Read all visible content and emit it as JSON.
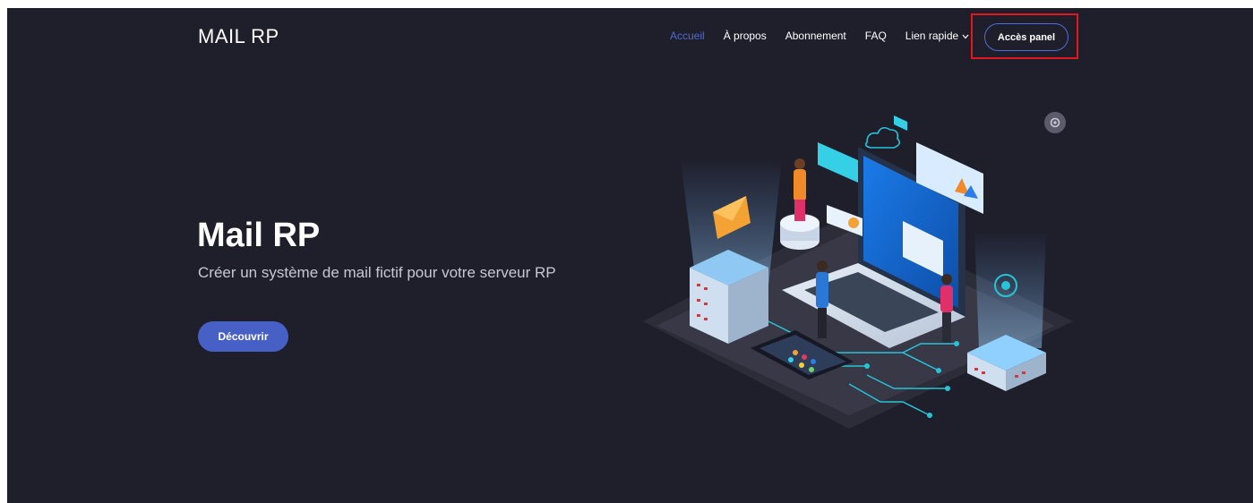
{
  "header": {
    "logo": "MAIL RP",
    "nav": [
      {
        "label": "Accueil",
        "active": true
      },
      {
        "label": "À propos",
        "active": false
      },
      {
        "label": "Abonnement",
        "active": false
      },
      {
        "label": "FAQ",
        "active": false
      },
      {
        "label": "Lien rapide",
        "active": false,
        "has_dropdown": true
      }
    ],
    "cta_label": "Accès panel"
  },
  "hero": {
    "title": "Mail RP",
    "subtitle": "Créer un système de mail fictif pour votre serveur RP",
    "button_label": "Découvrir"
  },
  "colors": {
    "background": "#1f1f2c",
    "accent": "#4760c5",
    "active_link": "#4d6bd6",
    "highlight_box": "#e3181f"
  },
  "icons": {
    "nav_dropdown": "chevron-down-icon",
    "floating_button": "settings-icon"
  }
}
